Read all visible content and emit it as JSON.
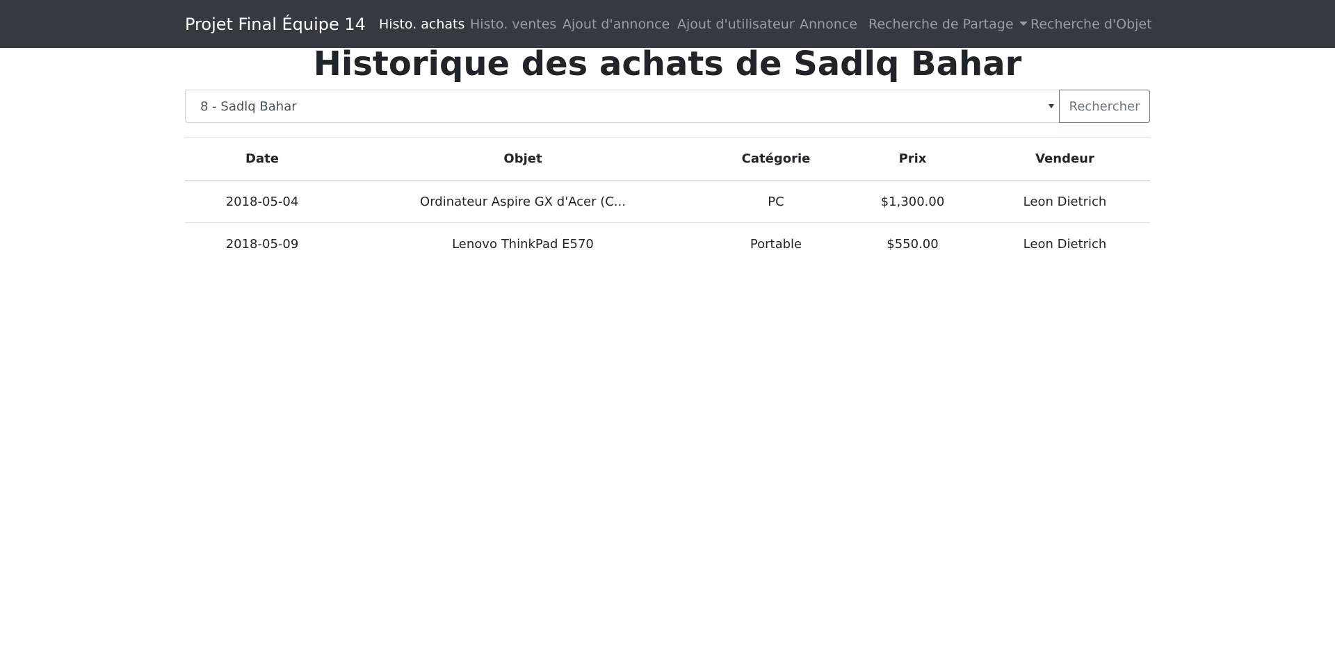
{
  "nav": {
    "brand": "Projet Final Équipe 14",
    "links": [
      "Histo. achats",
      "Histo. ventes",
      "Ajout d'annonce",
      "Ajout d'utilisateur",
      "Annonce",
      "Recherche de Partage",
      "Recherche d'Objet"
    ]
  },
  "page": {
    "title": "Historique des achats de Sadlq Bahar"
  },
  "search": {
    "selected": "8 - Sadlq Bahar",
    "button": "Rechercher"
  },
  "table": {
    "headers": [
      "Date",
      "Objet",
      "Catégorie",
      "Prix",
      "Vendeur"
    ],
    "rows": [
      [
        "2018-05-04",
        "Ordinateur Aspire GX d'Acer (C...",
        "PC",
        "$1,300.00",
        "Leon Dietrich"
      ],
      [
        "2018-05-09",
        "Lenovo ThinkPad E570",
        "Portable",
        "$550.00",
        "Leon Dietrich"
      ]
    ]
  },
  "colors": {
    "navbar_bg": "#343a40",
    "text": "#212529",
    "border": "#dee2e6"
  }
}
